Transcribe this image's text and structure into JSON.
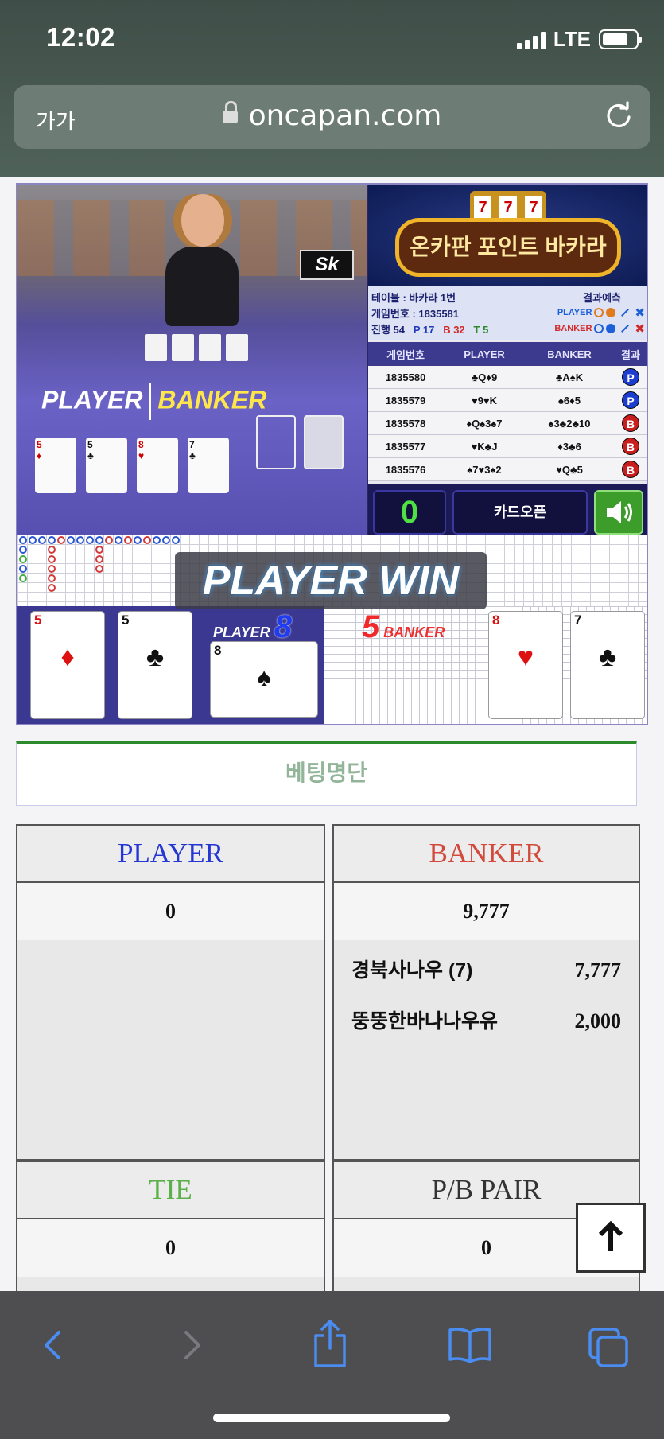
{
  "status": {
    "time": "12:02",
    "network": "LTE"
  },
  "browser": {
    "aa_label": "가가",
    "url": "oncapan.com"
  },
  "game": {
    "cam_overlay": {
      "player": "PLAYER",
      "banker": "BANKER"
    },
    "sky_sign": "Sk",
    "logo_text": "온카판 포인트 바카라",
    "slot_reels": [
      "7",
      "7",
      "7"
    ],
    "info": {
      "table_label": "테이블 : 바카라 1번",
      "prediction_label": "결과예측",
      "game_no_label": "게임번호 : 1835581",
      "pred_player": "PLAYER",
      "pred_banker": "BANKER",
      "progress_label": "진행 54",
      "p_count": "P 17",
      "b_count": "B 32",
      "t_count": "T 5"
    },
    "history": {
      "headers": [
        "게임번호",
        "PLAYER",
        "BANKER",
        "결과"
      ],
      "rows": [
        {
          "no": "1835580",
          "player": "♣Q♦9",
          "banker": "♣A♠K",
          "result": "P"
        },
        {
          "no": "1835579",
          "player": "♥9♥K",
          "banker": "♠6♦5",
          "result": "P"
        },
        {
          "no": "1835578",
          "player": "♦Q♠3♠7",
          "banker": "♠3♣2♣10",
          "result": "B"
        },
        {
          "no": "1835577",
          "player": "♥K♣J",
          "banker": "♦3♣6",
          "result": "B"
        },
        {
          "no": "1835576",
          "player": "♠7♥3♠2",
          "banker": "♥Q♣5",
          "result": "B"
        }
      ]
    },
    "counter": "0",
    "card_open_label": "카드오픈",
    "win_banner": "PLAYER WIN",
    "player_label": "PLAYER",
    "player_score": "8",
    "banker_label": "BANKER",
    "banker_score": "5",
    "player_cards": [
      {
        "rank": "5",
        "suit": "♦",
        "color": "red"
      },
      {
        "rank": "5",
        "suit": "♣",
        "color": "black"
      },
      {
        "rank": "8",
        "suit": "♠",
        "color": "black"
      }
    ],
    "banker_cards": [
      {
        "rank": "8",
        "suit": "♥",
        "color": "red"
      },
      {
        "rank": "7",
        "suit": "♣",
        "color": "black"
      }
    ]
  },
  "bets": {
    "title": "베팅명단",
    "player": {
      "label": "PLAYER",
      "total": "0",
      "color": "#2436d4"
    },
    "banker": {
      "label": "BANKER",
      "total": "9,777",
      "color": "#d24a3c",
      "bettors": [
        {
          "name": "경북사나우 (7)",
          "amount": "7,777"
        },
        {
          "name": "뚱뚱한바나나우유",
          "amount": "2,000"
        }
      ]
    },
    "tie": {
      "label": "TIE",
      "total": "0",
      "color": "#5cb04a"
    },
    "pair": {
      "label": "P/B PAIR",
      "total": "0",
      "color": "#333333"
    }
  }
}
